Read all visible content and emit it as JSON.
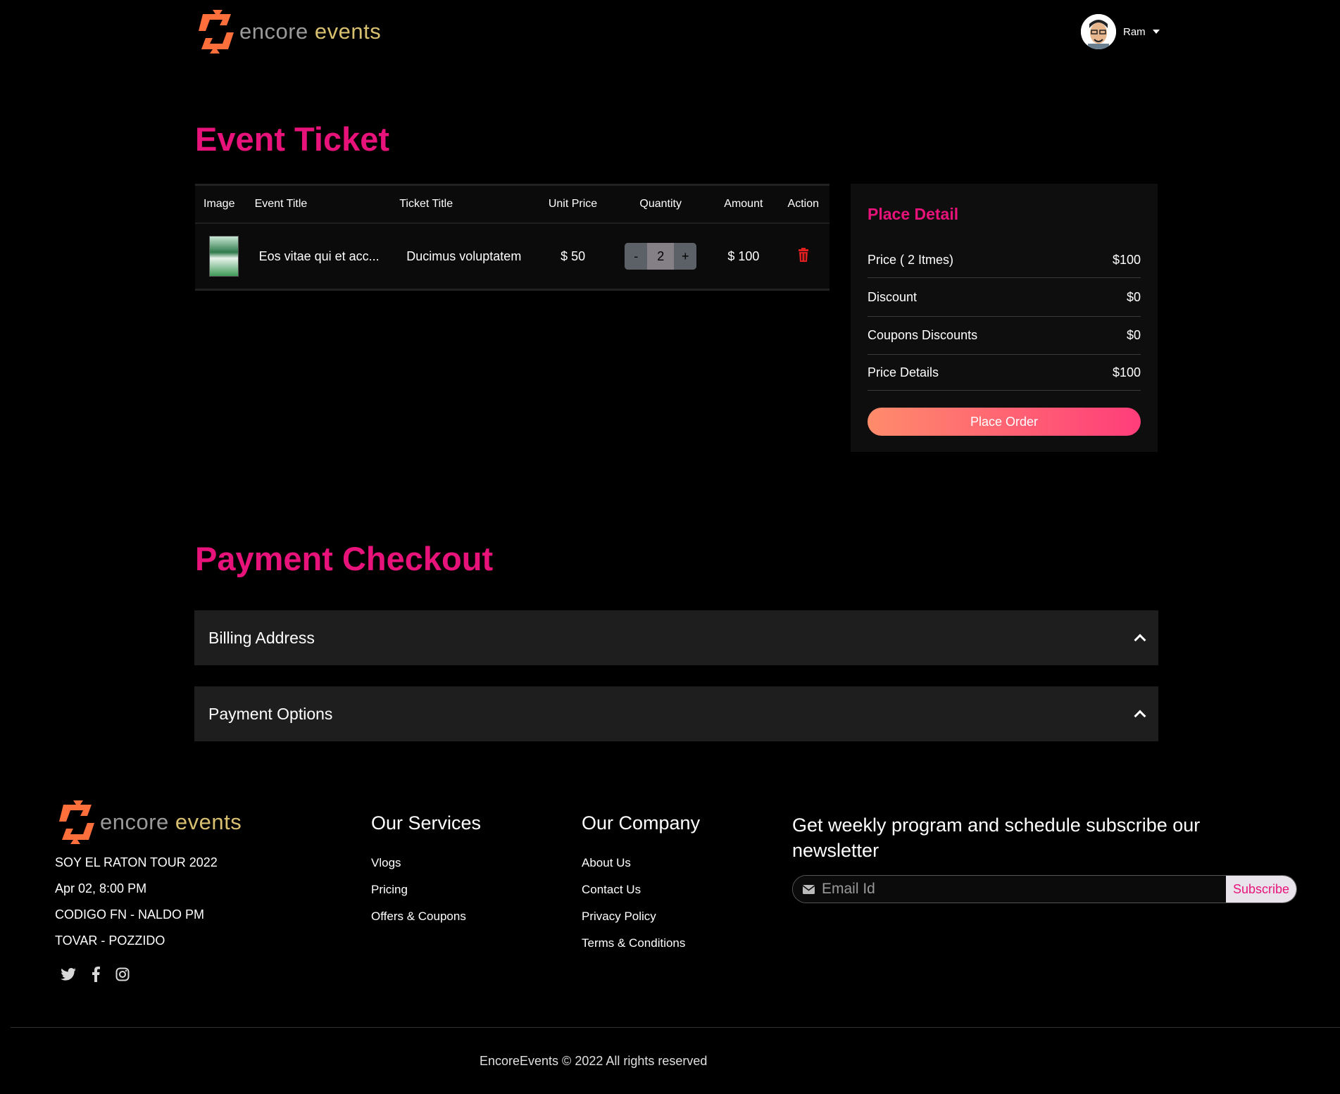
{
  "header": {
    "logo": {
      "word1": "encore",
      "word2": "events"
    },
    "user": {
      "name": "Ram"
    }
  },
  "ticket_section": {
    "title": "Event Ticket",
    "columns": [
      "Image",
      "Event Title",
      "Ticket Title",
      "Unit Price",
      "Quantity",
      "Amount",
      "Action"
    ],
    "rows": [
      {
        "event_title": "Eos vitae qui et acc...",
        "ticket_title": "Ducimus voluptatem",
        "unit_price": "$ 50",
        "quantity_minus": "-",
        "quantity": "2",
        "quantity_plus": "+",
        "amount": "$ 100"
      }
    ]
  },
  "place_detail": {
    "title": "Place Detail",
    "rows": [
      {
        "label": "Price ( 2 Itmes)",
        "value": "$100"
      },
      {
        "label": "Discount",
        "value": "$0"
      },
      {
        "label": "Coupons Discounts",
        "value": "$0"
      },
      {
        "label": "Price Details",
        "value": "$100"
      }
    ],
    "button": "Place Order"
  },
  "payment_section": {
    "title": "Payment Checkout",
    "panels": [
      {
        "label": "Billing Address"
      },
      {
        "label": "Payment Options"
      }
    ]
  },
  "footer": {
    "logo": {
      "word1": "encore",
      "word2": "events"
    },
    "event_lines": [
      "SOY EL RATON TOUR 2022",
      "Apr 02, 8:00 PM",
      "CODIGO FN - NALDO PM",
      "TOVAR - POZZIDO"
    ],
    "social_icons": [
      "twitter-icon",
      "facebook-icon",
      "instagram-icon"
    ],
    "services": {
      "heading": "Our Services",
      "links": [
        "Vlogs",
        "Pricing",
        "Offers & Coupons"
      ]
    },
    "company": {
      "heading": "Our Company",
      "links": [
        "About Us",
        "Contact Us",
        "Privacy Policy",
        "Terms & Conditions"
      ]
    },
    "newsletter": {
      "heading": "Get weekly program and schedule subscribe our newsletter",
      "placeholder": "Email Id",
      "button": "Subscribe"
    },
    "copyright": "EncoreEvents © 2022 All rights reserved"
  },
  "colors": {
    "accent": "#e8137a",
    "button_gradient_start": "#ff8c6b",
    "button_gradient_end": "#ff3d7a",
    "delete": "#e02020"
  }
}
